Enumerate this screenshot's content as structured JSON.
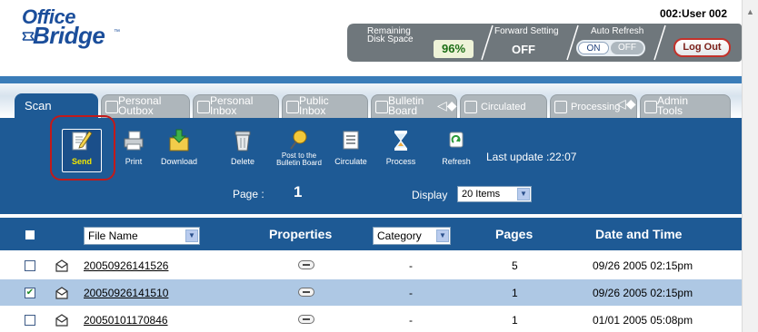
{
  "app": {
    "logo_top": "Office",
    "logo_bottom": "Bridge",
    "user": "002:User 002"
  },
  "status": {
    "disk_label_1": "Remaining",
    "disk_label_2": "Disk Space",
    "disk_value": "96%",
    "forward_label": "Forward Setting",
    "forward_value": "OFF",
    "refresh_label": "Auto Refresh",
    "refresh_on": "ON",
    "refresh_off": "OFF",
    "logout": "Log Out"
  },
  "tabs": [
    {
      "label": "Scan"
    },
    {
      "line1": "Personal",
      "line2": "Outbox"
    },
    {
      "line1": "Personal",
      "line2": "Inbox"
    },
    {
      "line1": "Public",
      "line2": "Inbox"
    },
    {
      "line1": "Bulletin",
      "line2": "Board"
    },
    {
      "label": "Circulated"
    },
    {
      "label": "Processing"
    },
    {
      "line1": "Admin",
      "line2": "Tools"
    }
  ],
  "toolbar": {
    "send": "Send",
    "print": "Print",
    "download": "Download",
    "delete": "Delete",
    "post_1": "Post to the",
    "post_2": "Bulletin Board",
    "circulate": "Circulate",
    "process": "Process",
    "refresh": "Refresh",
    "last_update": "Last update :22:07",
    "page_label": "Page :",
    "page_number": "1",
    "display_label": "Display",
    "display_value": "20 Items"
  },
  "table": {
    "file_name_select": "File Name",
    "properties": "Properties",
    "category_select": "Category",
    "pages": "Pages",
    "date_time": "Date and Time",
    "rows": [
      {
        "file": "20050926141526",
        "category": "-",
        "pages": "5",
        "date": "09/26 2005 02:15pm",
        "checked": false
      },
      {
        "file": "20050926141510",
        "category": "-",
        "pages": "1",
        "date": "09/26 2005 02:15pm",
        "checked": true
      },
      {
        "file": "20050101170846",
        "category": "-",
        "pages": "1",
        "date": "01/01 2005 05:08pm",
        "checked": false
      }
    ]
  },
  "colors": {
    "brand_blue": "#1e5a95",
    "selected_row": "#aec8e4",
    "highlight_red": "#c21a1a"
  }
}
